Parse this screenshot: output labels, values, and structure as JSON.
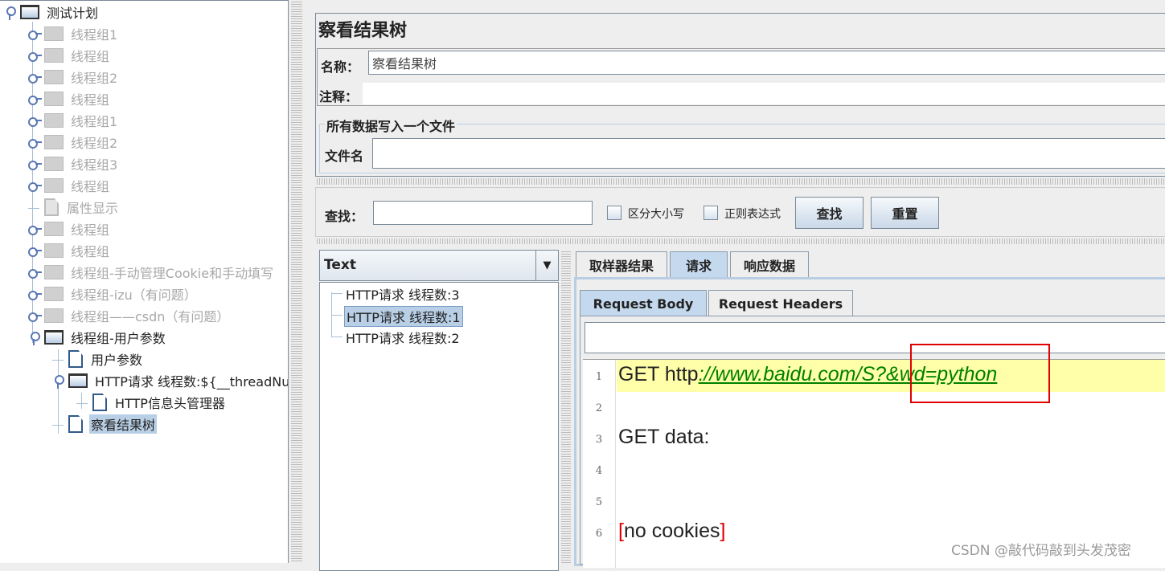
{
  "tree": {
    "items": [
      {
        "label": "测试计划",
        "level": 0,
        "icon": "folder-open-icon",
        "state": "expanded",
        "disabled": false
      },
      {
        "label": "线程组1",
        "level": 1,
        "icon": "folder-icon",
        "state": "collapsed",
        "disabled": true
      },
      {
        "label": "线程组",
        "level": 1,
        "icon": "folder-icon",
        "state": "collapsed",
        "disabled": true
      },
      {
        "label": "线程组2",
        "level": 1,
        "icon": "folder-icon",
        "state": "collapsed",
        "disabled": true
      },
      {
        "label": "线程组",
        "level": 1,
        "icon": "folder-icon",
        "state": "collapsed",
        "disabled": true
      },
      {
        "label": "线程组1",
        "level": 1,
        "icon": "folder-icon",
        "state": "collapsed",
        "disabled": true
      },
      {
        "label": "线程组2",
        "level": 1,
        "icon": "folder-icon",
        "state": "collapsed",
        "disabled": true
      },
      {
        "label": "线程组3",
        "level": 1,
        "icon": "folder-icon",
        "state": "collapsed",
        "disabled": true
      },
      {
        "label": "线程组",
        "level": 1,
        "icon": "folder-icon",
        "state": "collapsed",
        "disabled": true
      },
      {
        "label": "属性显示",
        "level": 1,
        "icon": "document-icon",
        "state": "leaf",
        "disabled": true
      },
      {
        "label": "线程组",
        "level": 1,
        "icon": "folder-icon",
        "state": "collapsed",
        "disabled": true
      },
      {
        "label": "线程组",
        "level": 1,
        "icon": "folder-icon",
        "state": "collapsed",
        "disabled": true
      },
      {
        "label": "线程组-手动管理Cookie和手动填写",
        "level": 1,
        "icon": "folder-icon",
        "state": "collapsed",
        "disabled": true
      },
      {
        "label": "线程组-izu（有问题）",
        "level": 1,
        "icon": "folder-icon",
        "state": "collapsed",
        "disabled": true
      },
      {
        "label": "线程组——csdn（有问题）",
        "level": 1,
        "icon": "folder-icon",
        "state": "collapsed",
        "disabled": true
      },
      {
        "label": "线程组-用户参数",
        "level": 1,
        "icon": "folder-open-icon",
        "state": "expanded",
        "disabled": false
      },
      {
        "label": "用户参数",
        "level": 2,
        "icon": "document-icon",
        "state": "leaf",
        "disabled": false
      },
      {
        "label": "HTTP请求 线程数:${__threadNum}",
        "level": 2,
        "icon": "folder-open-icon",
        "state": "expanded",
        "disabled": false
      },
      {
        "label": "HTTP信息头管理器",
        "level": 3,
        "icon": "document-icon",
        "state": "leaf",
        "disabled": false
      },
      {
        "label": "察看结果树",
        "level": 2,
        "icon": "document-icon",
        "state": "leaf",
        "disabled": false,
        "selected": true
      }
    ]
  },
  "panel": {
    "title": "察看结果树",
    "name_label": "名称：",
    "name_value": "察看结果树",
    "comment_label": "注释：",
    "comment_value": "",
    "file_group_title": "所有数据写入一个文件",
    "filename_label": "文件名",
    "filename_value": ""
  },
  "search": {
    "label": "查找：",
    "value": "",
    "case_label": "区分大小写",
    "case_checked": false,
    "regex_label": "正则表达式",
    "regex_checked": false,
    "find_button": "查找",
    "reset_button": "重置"
  },
  "results": {
    "renderer": "Text",
    "samples": [
      {
        "label": "HTTP请求 线程数:3",
        "selected": false
      },
      {
        "label": "HTTP请求 线程数:1",
        "selected": true
      },
      {
        "label": "HTTP请求 线程数:2",
        "selected": false
      }
    ]
  },
  "tabs": [
    {
      "label": "取样器结果",
      "active": false
    },
    {
      "label": "请求",
      "active": true
    },
    {
      "label": "响应数据",
      "active": false
    }
  ],
  "subtabs": [
    {
      "label": "Request Body",
      "active": true
    },
    {
      "label": "Request Headers",
      "active": false
    }
  ],
  "editor": {
    "lines": [
      {
        "num": "1",
        "prefix": "GET http",
        "link": "://www.baidu.com/S?&wd=python"
      },
      {
        "num": "2",
        "text": ""
      },
      {
        "num": "3",
        "text": "GET data:"
      },
      {
        "num": "4",
        "text": ""
      },
      {
        "num": "5",
        "text": ""
      },
      {
        "num": "6",
        "bracket_open": "[",
        "text": "no cookies",
        "bracket_close": "]"
      }
    ]
  },
  "watermark": "CSDN @敲代码敲到头发茂密",
  "colors": {
    "selection": "#b8cfe5",
    "active_tab": "#c5d9ee",
    "highlight_line": "#ffffaa",
    "link": "#008000",
    "annotation_box": "#e00000"
  }
}
